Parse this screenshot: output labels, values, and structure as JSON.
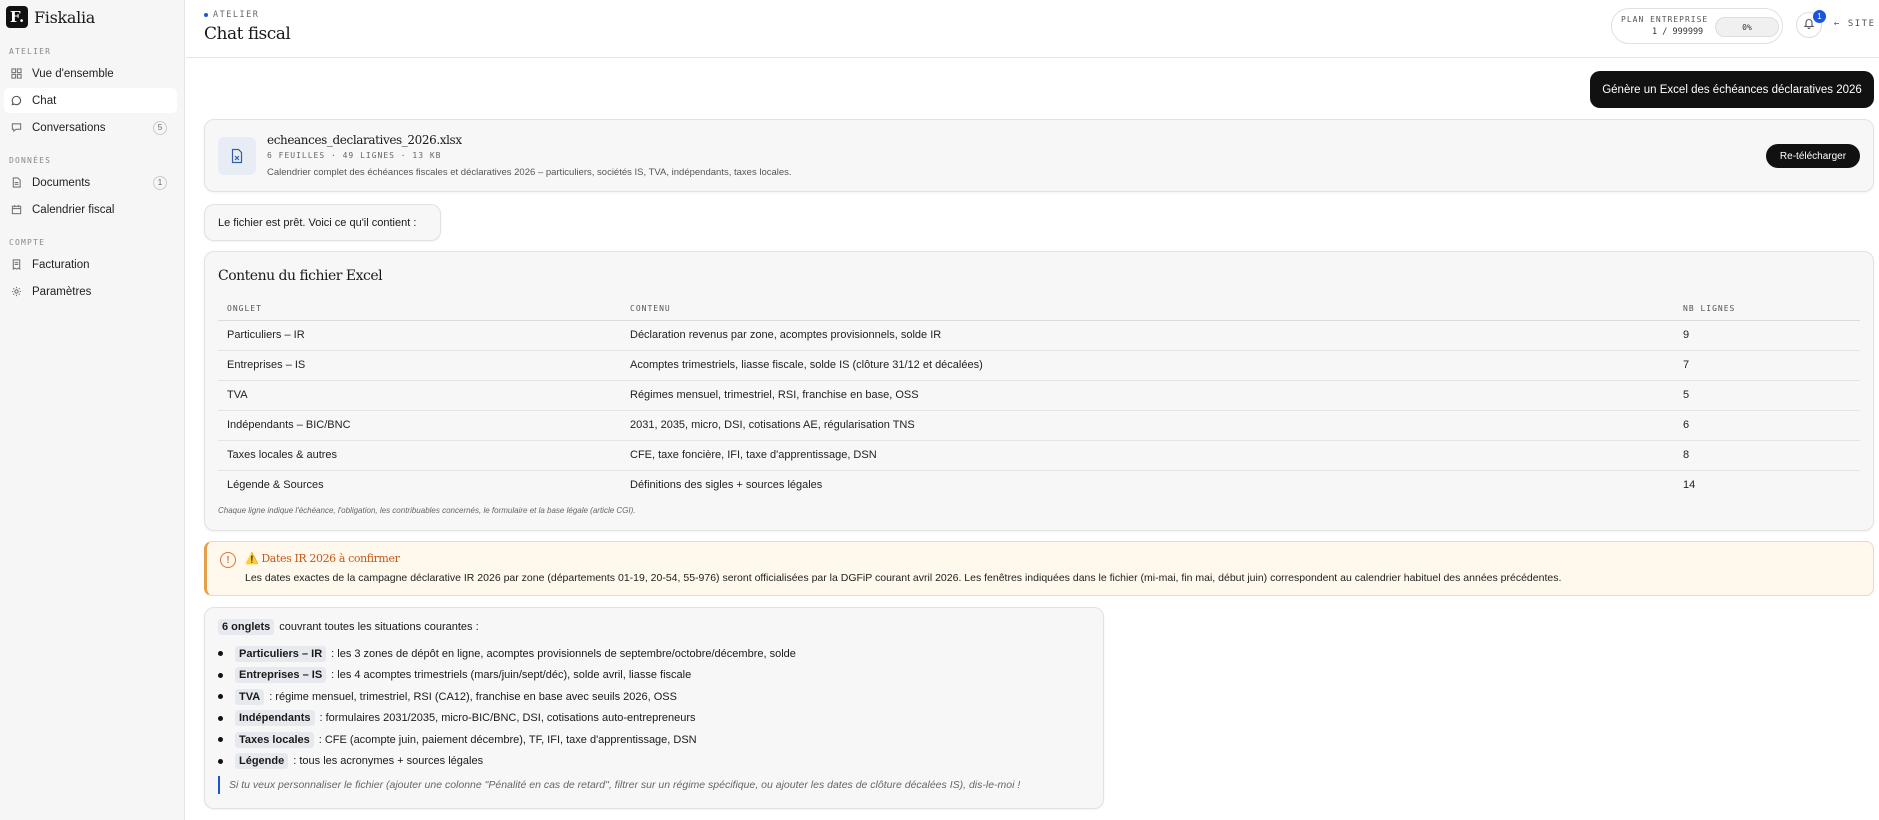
{
  "brand": {
    "logo_letter": "F.",
    "name": "Fiskalia"
  },
  "sidebar": {
    "sections": [
      {
        "label": "ATELIER",
        "items": [
          {
            "label": "Vue d'ensemble",
            "icon": "grid-icon"
          },
          {
            "label": "Chat",
            "icon": "chat-icon",
            "active": true
          },
          {
            "label": "Conversations",
            "icon": "message-square-icon",
            "count": "5"
          }
        ]
      },
      {
        "label": "DONNÉES",
        "items": [
          {
            "label": "Documents",
            "icon": "file-icon",
            "count": "1"
          },
          {
            "label": "Calendrier fiscal",
            "icon": "calendar-icon"
          }
        ]
      },
      {
        "label": "COMPTE",
        "items": [
          {
            "label": "Facturation",
            "icon": "receipt-icon"
          },
          {
            "label": "Paramètres",
            "icon": "gear-icon"
          }
        ]
      }
    ]
  },
  "header": {
    "crumb": "ATELIER",
    "title": "Chat fiscal",
    "plan": {
      "label": "PLAN ENTREPRISE",
      "usage": "1 / 999999",
      "percent_label": "0%",
      "percent": 0
    },
    "notifications_count": "1",
    "site_link": "← SITE"
  },
  "chat": {
    "user_message": "Génère un Excel des échéances déclaratives 2026",
    "file": {
      "name": "echeances_declaratives_2026.xlsx",
      "meta": "6 FEUILLES · 49 LIGNES · 13 KB",
      "description": "Calendrier complet des échéances fiscales et déclaratives 2026 – particuliers, sociétés IS, TVA, indépendants, taxes locales.",
      "button": "Re-télécharger"
    },
    "bot_intro": "Le fichier est prêt. Voici ce qu'il contient :",
    "table": {
      "title": "Contenu du fichier Excel",
      "headers": [
        "ONGLET",
        "CONTENU",
        "NB LIGNES"
      ],
      "rows": [
        [
          "Particuliers – IR",
          "Déclaration revenus par zone, acomptes provisionnels, solde IR",
          "9"
        ],
        [
          "Entreprises – IS",
          "Acomptes trimestriels, liasse fiscale, solde IS (clôture 31/12 et décalées)",
          "7"
        ],
        [
          "TVA",
          "Régimes mensuel, trimestriel, RSI, franchise en base, OSS",
          "5"
        ],
        [
          "Indépendants – BIC/BNC",
          "2031, 2035, micro, DSI, cotisations AE, régularisation TNS",
          "6"
        ],
        [
          "Taxes locales & autres",
          "CFE, taxe foncière, IFI, taxe d'apprentissage, DSN",
          "8"
        ],
        [
          "Légende & Sources",
          "Définitions des sigles + sources légales",
          "14"
        ]
      ],
      "note": "Chaque ligne indique l'échéance, l'obligation, les contribuables concernés, le formulaire et la base légale (article CGI)."
    },
    "warning": {
      "title": "⚠️ Dates IR 2026 à confirmer",
      "text": "Les dates exactes de la campagne déclarative IR 2026 par zone (départements 01-19, 20-54, 55-976) seront officialisées par la DGFiP courant avril 2026. Les fenêtres indiquées dans le fichier (mi-mai, fin mai, début juin) correspondent au calendrier habituel des années précédentes."
    },
    "summary": {
      "intro_chip": "6 onglets",
      "intro_text": "couvrant toutes les situations courantes :",
      "items": [
        {
          "chip": "Particuliers – IR",
          "text": ": les 3 zones de dépôt en ligne, acomptes provisionnels de septembre/octobre/décembre, solde"
        },
        {
          "chip": "Entreprises – IS",
          "text": ": les 4 acomptes trimestriels (mars/juin/sept/déc), solde avril, liasse fiscale"
        },
        {
          "chip": "TVA",
          "text": ": régime mensuel, trimestriel, RSI (CA12), franchise en base avec seuils 2026, OSS"
        },
        {
          "chip": "Indépendants",
          "text": ": formulaires 2031/2035, micro-BIC/BNC, DSI, cotisations auto-entrepreneurs"
        },
        {
          "chip": "Taxes locales",
          "text": ": CFE (acompte juin, paiement décembre), TF, IFI, taxe d'apprentissage, DSN"
        },
        {
          "chip": "Légende",
          "text": ": tous les acronymes + sources légales"
        }
      ],
      "quote": "Si tu veux personnaliser le fichier (ajouter une colonne \"Pénalité en cas de retard\", filtrer sur un régime spécifique, ou ajouter les dates de clôture décalées IS), dis-le-moi !"
    }
  }
}
